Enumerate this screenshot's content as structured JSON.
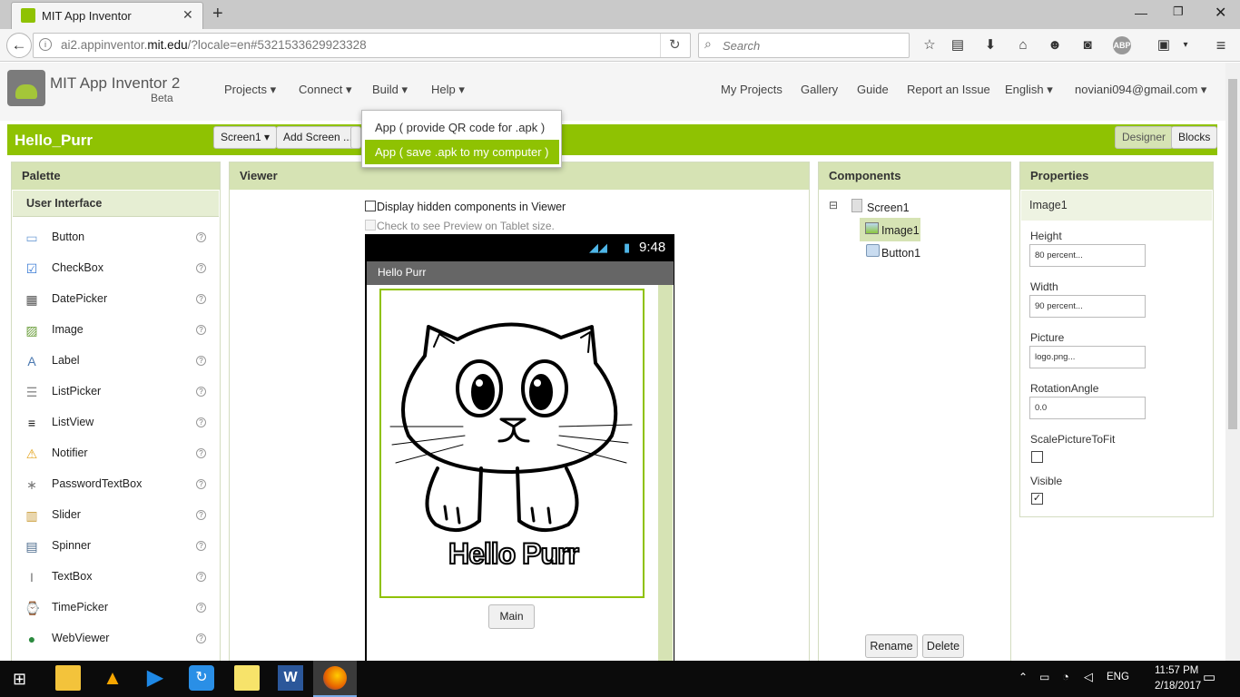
{
  "browser": {
    "tab_title": "MIT App Inventor",
    "url_gray_prefix": "ai2.appinventor.",
    "url_host": "mit.edu",
    "url_rest": "/?locale=en#5321533629923328",
    "search_placeholder": "Search",
    "new_tab": "+",
    "close_tab": "✕"
  },
  "app": {
    "title": "MIT App Inventor 2",
    "subtitle": "Beta",
    "menus": [
      "Projects ▾",
      "Connect ▾",
      "Build ▾",
      "Help ▾"
    ],
    "right_links": [
      "My Projects",
      "Gallery",
      "Guide",
      "Report an Issue",
      "English ▾",
      "noviani094@gmail.com ▾"
    ]
  },
  "project": {
    "name": "Hello_Purr",
    "screen_select": "Screen1 ▾",
    "add_screen": "Add Screen ...",
    "designer": "Designer",
    "blocks": "Blocks"
  },
  "build_menu": {
    "items": [
      "App ( provide QR code for .apk )",
      "App ( save .apk to my computer )"
    ]
  },
  "palette": {
    "title": "Palette",
    "section": "User Interface",
    "items": [
      "Button",
      "CheckBox",
      "DatePicker",
      "Image",
      "Label",
      "ListPicker",
      "ListView",
      "Notifier",
      "PasswordTextBox",
      "Slider",
      "Spinner",
      "TextBox",
      "TimePicker",
      "WebViewer"
    ]
  },
  "viewer": {
    "title": "Viewer",
    "hidden_label": "Display hidden components in Viewer",
    "tablet_label": "Check to see Preview on Tablet size.",
    "phone_time": "9:48",
    "phone_title": "Hello Purr",
    "image_text": "Hello Purr",
    "main_button": "Main"
  },
  "components": {
    "title": "Components",
    "root": "Screen1",
    "children": [
      "Image1",
      "Button1"
    ],
    "rename": "Rename",
    "delete": "Delete",
    "collapse": "⊟"
  },
  "properties": {
    "title": "Properties",
    "component": "Image1",
    "height_label": "Height",
    "height_value": "80 percent...",
    "width_label": "Width",
    "width_value": "90 percent...",
    "picture_label": "Picture",
    "picture_value": "logo.png...",
    "rotation_label": "RotationAngle",
    "rotation_value": "0.0",
    "scale_label": "ScalePictureToFit",
    "visible_label": "Visible"
  },
  "taskbar": {
    "time": "11:57 PM",
    "date": "2/18/2017",
    "lang": "ENG"
  },
  "colors": {
    "green_bar": "#8fc202",
    "panel_header": "#d6e3b4",
    "highlight": "#8fc202"
  }
}
